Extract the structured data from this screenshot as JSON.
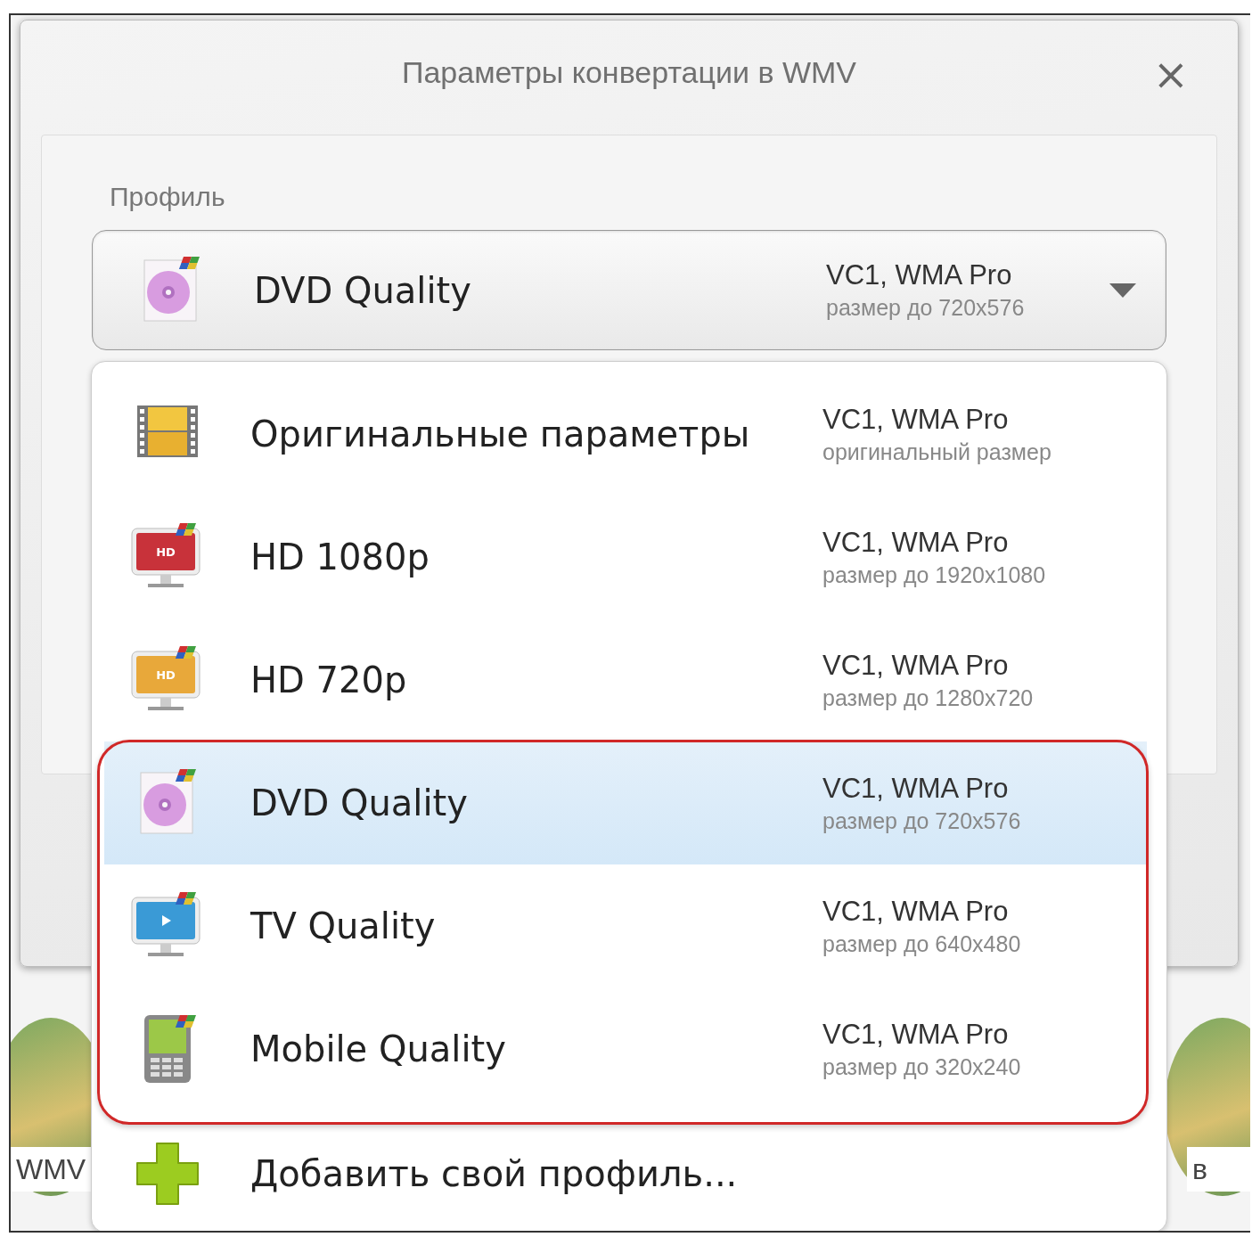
{
  "dialog": {
    "title": "Параметры конвертации в WMV",
    "close": "×"
  },
  "profile": {
    "label": "Профиль",
    "current": {
      "kind": "disc",
      "name": "DVD Quality",
      "codec": "VC1, WMA Pro",
      "size": "размер до 720x576"
    },
    "expanded": true
  },
  "options": [
    {
      "kind": "film",
      "name": "Оригинальные параметры",
      "codec": "VC1, WMA Pro",
      "size": "оригинальный размер",
      "selected": false,
      "highlighted": false
    },
    {
      "kind": "hd-red",
      "badge": "HD",
      "name": "HD 1080p",
      "codec": "VC1, WMA Pro",
      "size": "размер до 1920x1080",
      "selected": false,
      "highlighted": false
    },
    {
      "kind": "hd-orange",
      "badge": "HD",
      "name": "HD 720p",
      "codec": "VC1, WMA Pro",
      "size": "размер до 1280x720",
      "selected": false,
      "highlighted": false
    },
    {
      "kind": "disc",
      "name": "DVD Quality",
      "codec": "VC1, WMA Pro",
      "size": "размер до 720x576",
      "selected": true,
      "highlighted": true
    },
    {
      "kind": "tv",
      "name": "TV Quality",
      "codec": "VC1, WMA Pro",
      "size": "размер до 640x480",
      "selected": false,
      "highlighted": true
    },
    {
      "kind": "phone",
      "name": "Mobile Quality",
      "codec": "VC1, WMA Pro",
      "size": "размер до 320x240",
      "selected": false,
      "highlighted": true
    }
  ],
  "add_profile": {
    "label": "Добавить свой профиль..."
  },
  "background_tiles": [
    {
      "label": "WMV"
    },
    {
      "label": "в"
    }
  ]
}
